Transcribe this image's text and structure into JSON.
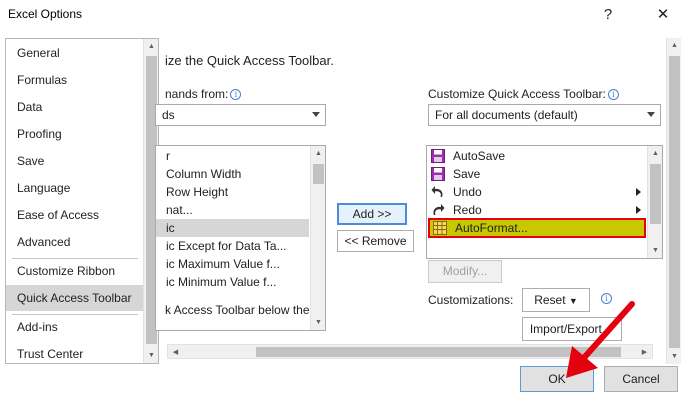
{
  "window": {
    "title": "Excel Options",
    "help_glyph": "?",
    "close_glyph": "✕"
  },
  "nav": {
    "items": [
      {
        "label": "General"
      },
      {
        "label": "Formulas"
      },
      {
        "label": "Data"
      },
      {
        "label": "Proofing"
      },
      {
        "label": "Save"
      },
      {
        "label": "Language"
      },
      {
        "label": "Ease of Access"
      },
      {
        "label": "Advanced"
      },
      {
        "label": "Customize Ribbon"
      },
      {
        "label": "Quick Access Toolbar"
      },
      {
        "label": "Add-ins"
      },
      {
        "label": "Trust Center"
      }
    ],
    "selected": "Quick Access Toolbar"
  },
  "main": {
    "heading": "ize the Quick Access Toolbar.",
    "commands_label": "nands from:",
    "commands_value": "ds",
    "commands_list": [
      "r",
      "Column Width",
      "Row Height",
      "nat...",
      "ic",
      "ic Except for Data Ta...",
      "ic Maximum Value f...",
      "ic Minimum Value f..."
    ],
    "commands_selected": "ic",
    "show_below_label": "k Access Toolbar below the",
    "add_label": "Add >>",
    "remove_label": "<< Remove",
    "qat_label": "Customize Quick Access Toolbar:",
    "qat_value": "For all documents (default)",
    "qat_list": [
      {
        "label": "AutoSave",
        "icon": "save-icon"
      },
      {
        "label": "Save",
        "icon": "save-icon"
      },
      {
        "label": "Undo",
        "icon": "undo-icon",
        "submenu": true
      },
      {
        "label": "Redo",
        "icon": "redo-icon",
        "submenu": true
      },
      {
        "label": "AutoFormat...",
        "icon": "table-format-icon"
      }
    ],
    "qat_selected": "AutoFormat...",
    "modify_label": "Modify...",
    "customizations_label": "Customizations:",
    "reset_label": "Reset",
    "import_export_label": "Import/Export"
  },
  "footer": {
    "ok_label": "OK",
    "cancel_label": "Cancel"
  },
  "colors": {
    "selection": "#d6d6d6",
    "highlight_border": "#e3000f",
    "highlight_fill": "#c8c800",
    "arrow": "#e3000f",
    "accent": "#4f8ad6"
  }
}
